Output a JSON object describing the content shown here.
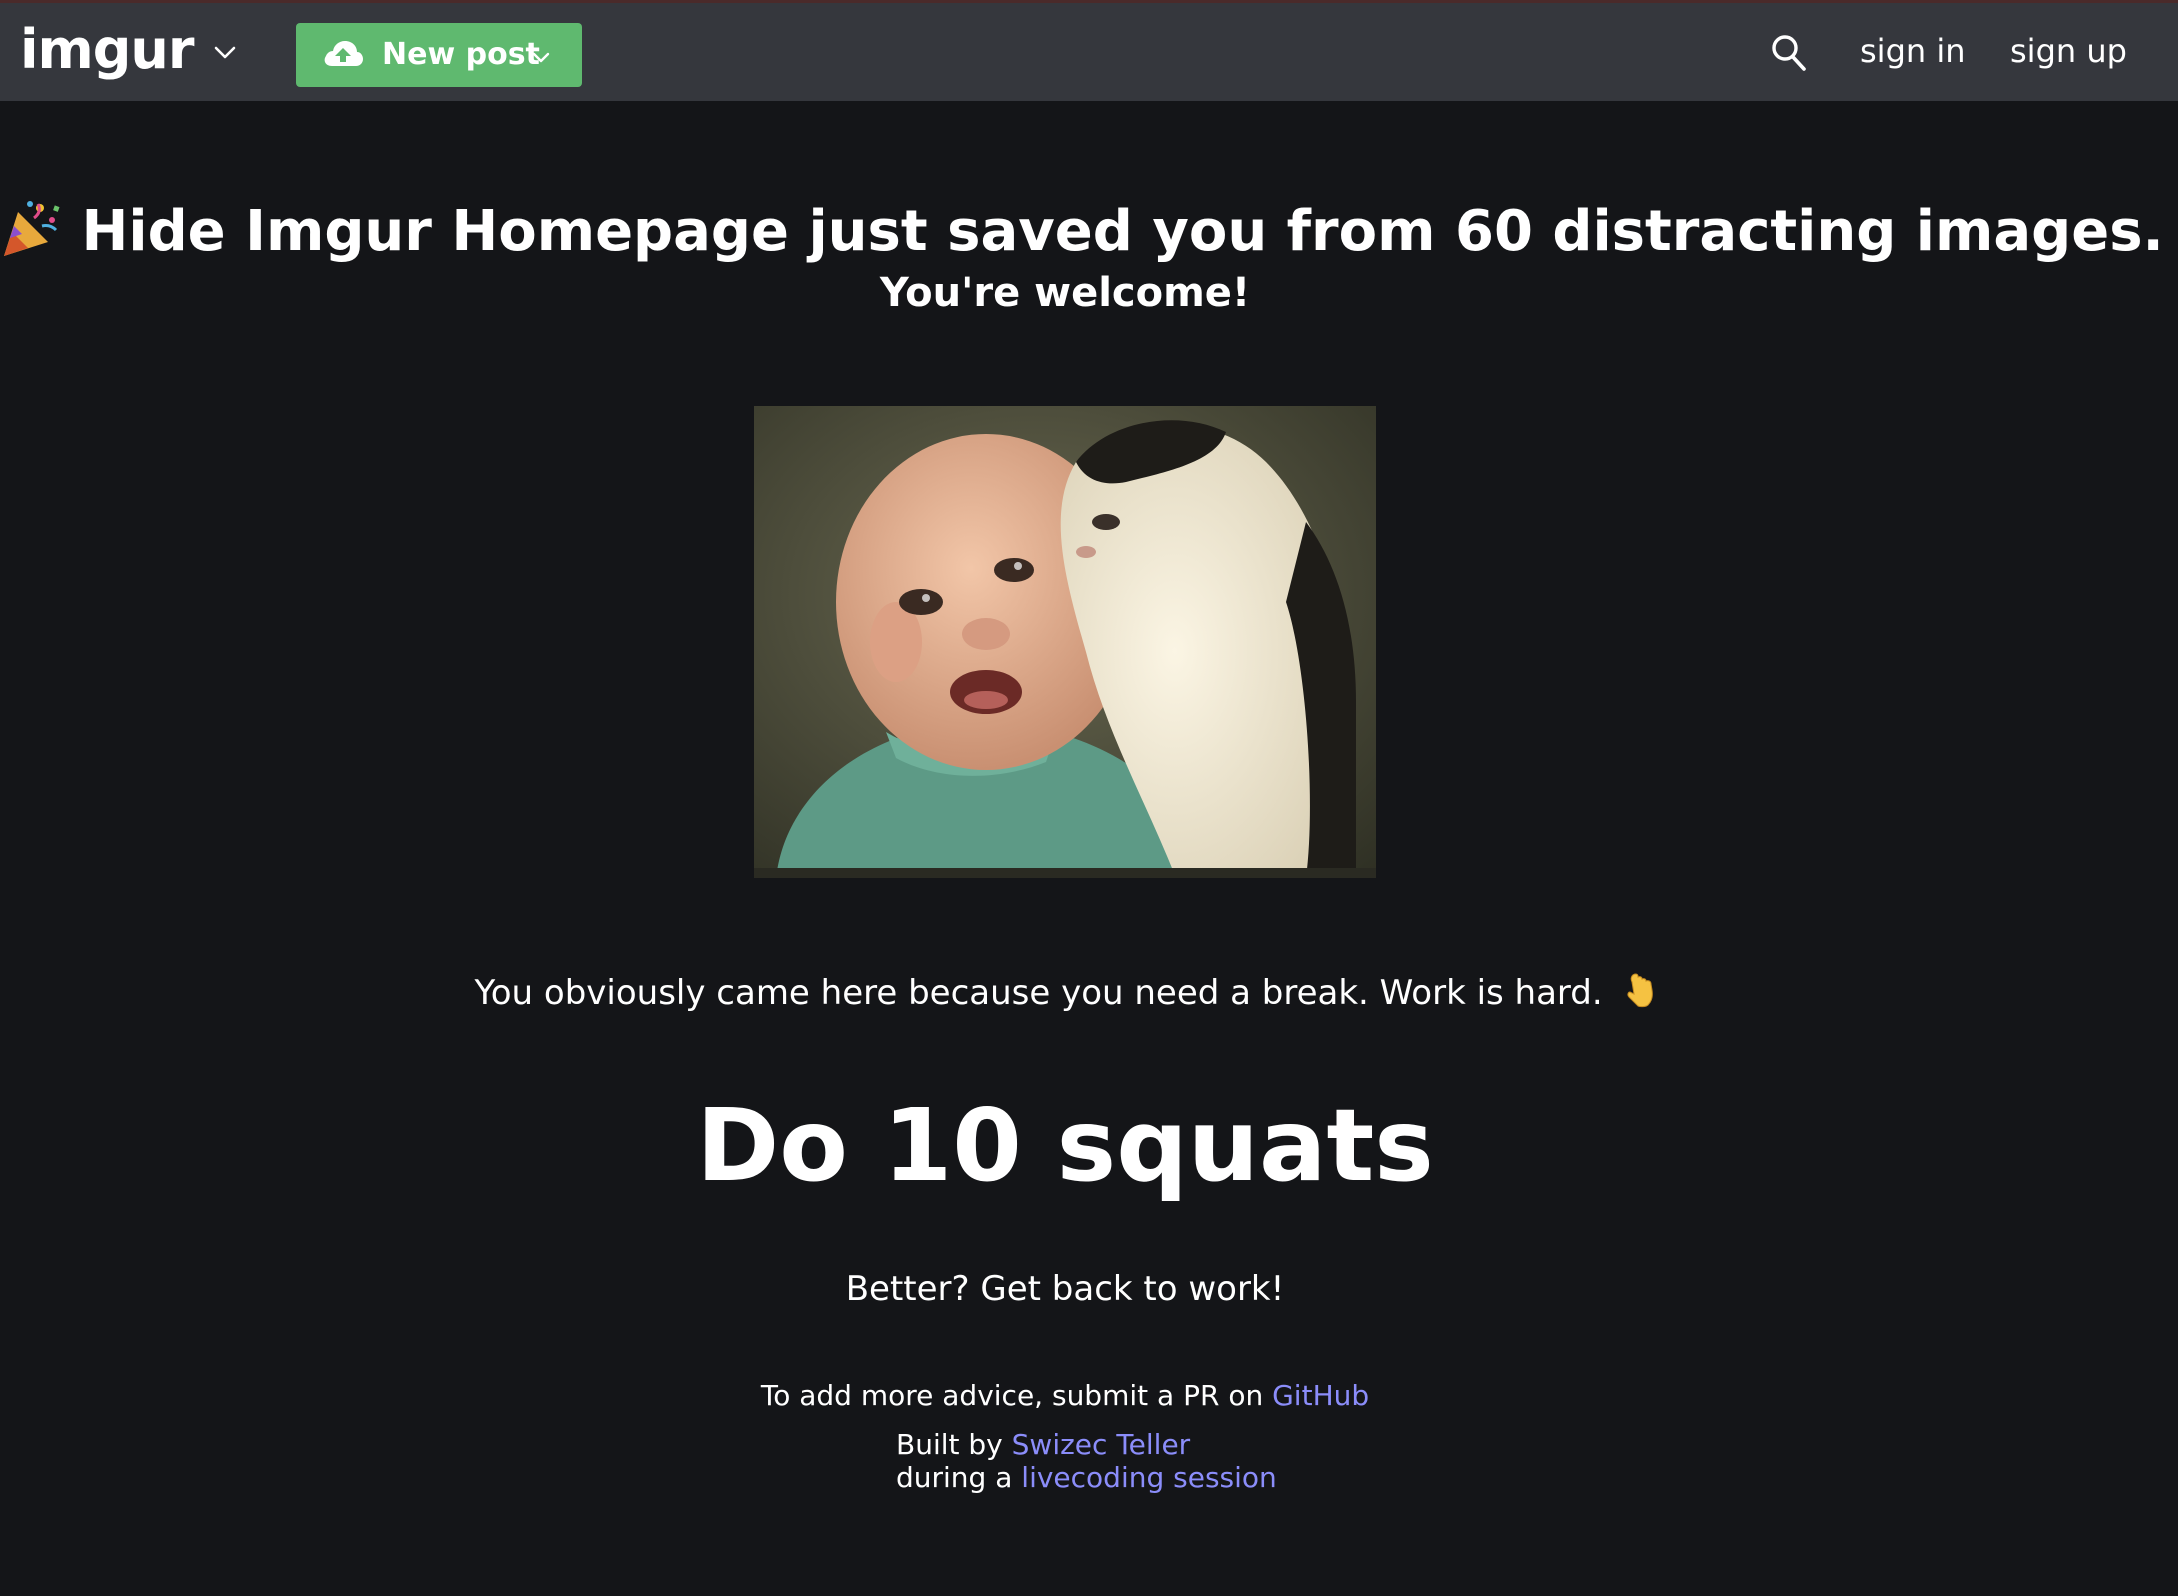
{
  "header": {
    "logo_text": "imgur",
    "new_post_label": "New post",
    "sign_in_label": "sign in",
    "sign_up_label": "sign up",
    "icons": [
      "chevron-down-icon",
      "upload-cloud-icon",
      "search-icon"
    ],
    "colors": {
      "bar": "#35373d",
      "new_post_button": "#5fb96f"
    }
  },
  "main": {
    "headline": "Hide Imgur Homepage just saved you from 60 distracting images.",
    "subhead": "You're welcome!",
    "break_text": "You obviously came here because you need a break. Work is hard.",
    "advice": "Do 10 squats",
    "better_text": "Better? Get back to work!",
    "pr_prefix": "To add more advice, submit a PR on",
    "pr_link": "GitHub",
    "built_by_prefix": "Built by",
    "author_link": "Swizec Teller",
    "during_prefix": "during a",
    "session_link": "livecoding session",
    "icons": [
      "party-popper-icon",
      "pointing-down-icon"
    ],
    "colors": {
      "background": "#141518",
      "link": "#8b8dfa"
    }
  }
}
